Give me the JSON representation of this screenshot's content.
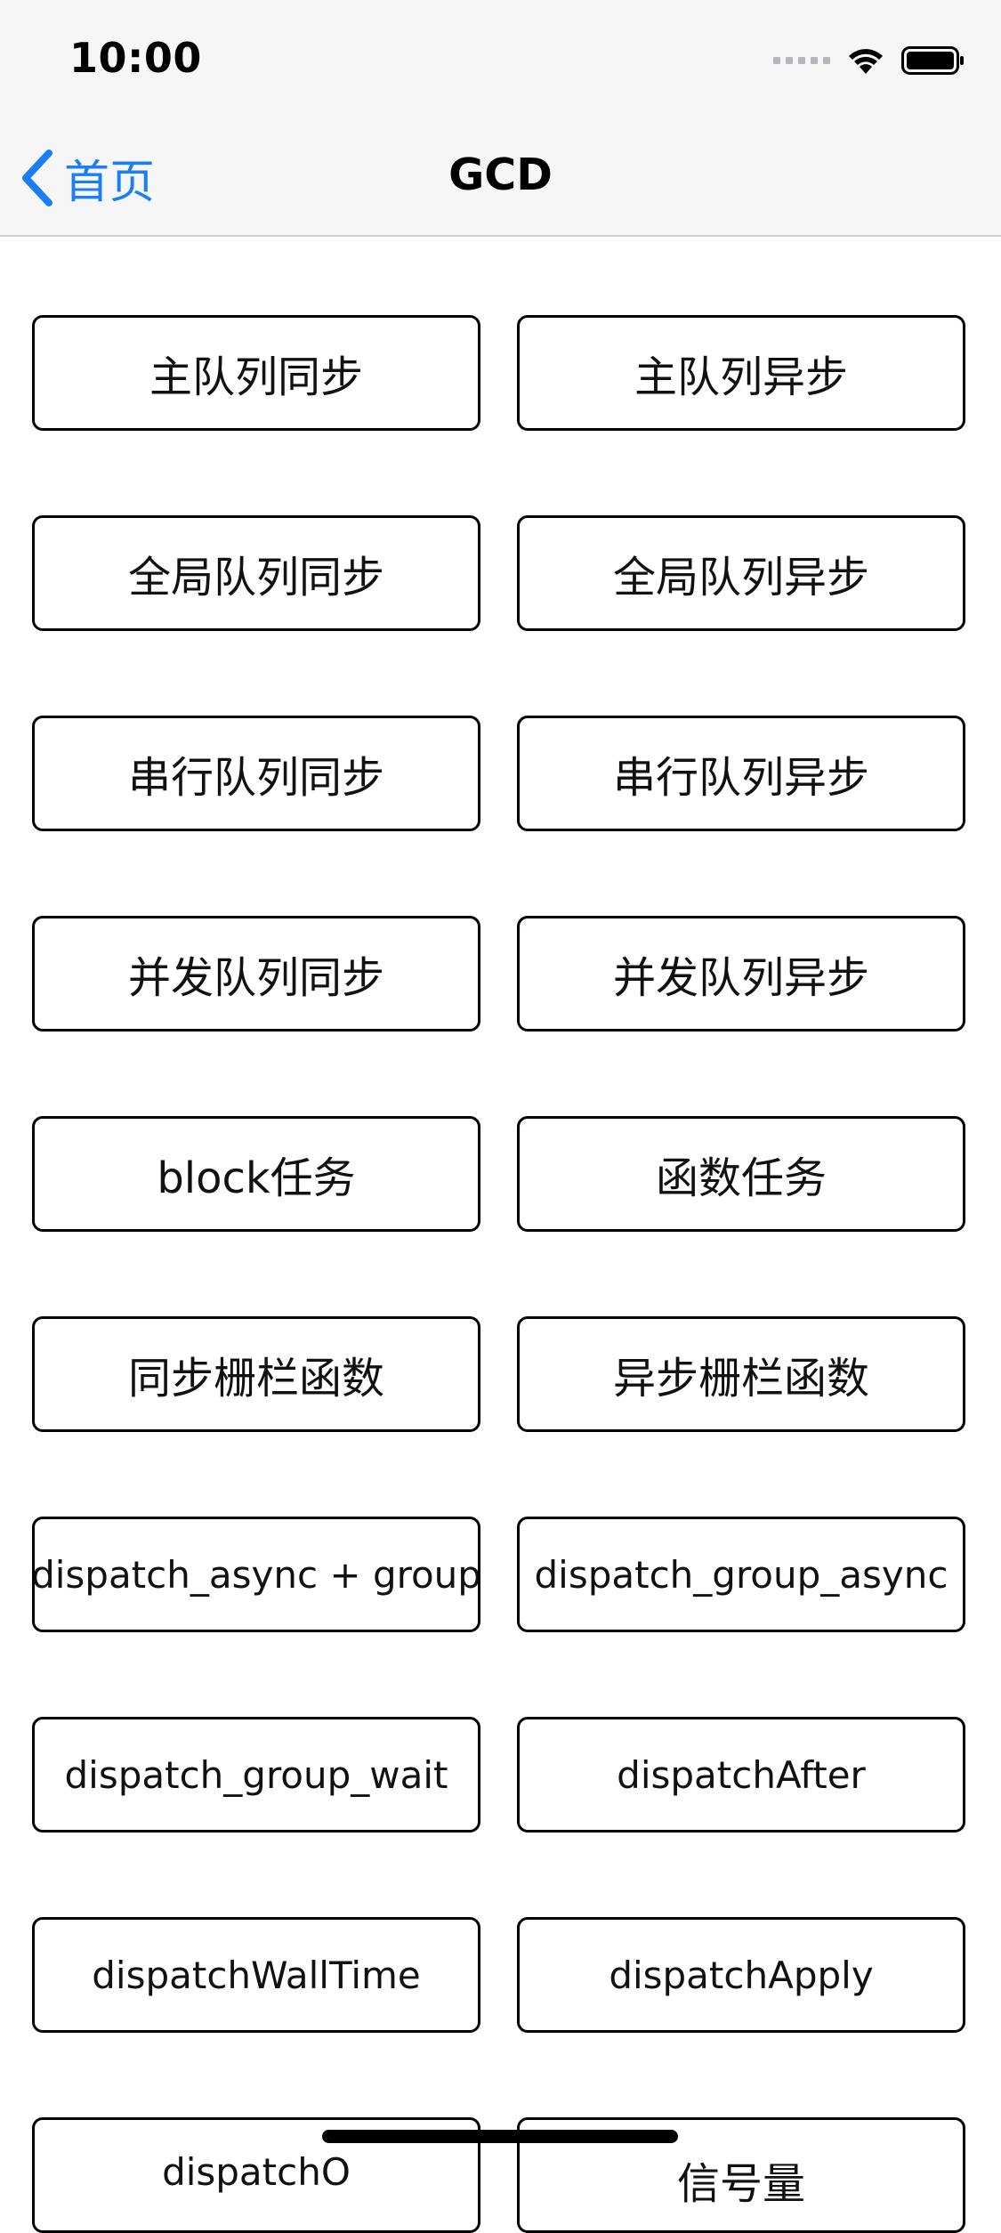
{
  "status_bar": {
    "time": "10:00"
  },
  "nav": {
    "back_label": "首页",
    "title": "GCD"
  },
  "buttons": {
    "row1": {
      "left": "主队列同步",
      "right": "主队列异步"
    },
    "row2": {
      "left": "全局队列同步",
      "right": "全局队列异步"
    },
    "row3": {
      "left": "串行队列同步",
      "right": "串行队列异步"
    },
    "row4": {
      "left": "并发队列同步",
      "right": "并发队列异步"
    },
    "row5": {
      "left": "block任务",
      "right": "函数任务"
    },
    "row6": {
      "left": "同步栅栏函数",
      "right": "异步栅栏函数"
    },
    "row7": {
      "left": "dispatch_async + group",
      "right": "dispatch_group_async"
    },
    "row8": {
      "left": "dispatch_group_wait",
      "right": "dispatchAfter"
    },
    "row9": {
      "left": "dispatchWallTime",
      "right": "dispatchApply"
    },
    "row10": {
      "left": "dispatchO",
      "right": "信号量"
    }
  },
  "colors": {
    "accent": "#1a7ef7",
    "header_bg": "#f6f6f7",
    "button_border": "#000000"
  },
  "icons": {
    "back": "chevron-left-icon",
    "signal": "signal-dots-icon",
    "wifi": "wifi-icon",
    "battery": "battery-icon"
  }
}
